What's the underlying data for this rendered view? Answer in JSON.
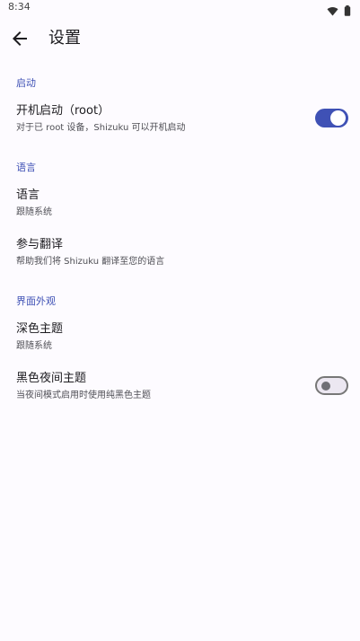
{
  "status_bar": {
    "time": "8:34",
    "icons": [
      "wifi-icon",
      "battery-icon"
    ]
  },
  "app_bar": {
    "title": "设置",
    "back_icon": "arrow-back-icon"
  },
  "sections": {
    "startup": {
      "title": "启动",
      "boot": {
        "title": "开机启动（root）",
        "subtitle": "对于已 root 设备，Shizuku 可以开机启动",
        "enabled": true
      }
    },
    "language": {
      "title": "语言",
      "language_item": {
        "title": "语言",
        "subtitle": "跟随系统"
      },
      "translate_item": {
        "title": "参与翻译",
        "subtitle": "帮助我们将 Shizuku 翻译至您的语言"
      }
    },
    "appearance": {
      "title": "界面外观",
      "dark_theme": {
        "title": "深色主题",
        "subtitle": "跟随系统"
      },
      "black_night": {
        "title": "黑色夜间主题",
        "subtitle": "当夜间模式启用时使用纯黑色主题",
        "enabled": false
      }
    }
  },
  "colors": {
    "accent": "#3f51b5",
    "background": "#fdfbff",
    "text_primary": "#1c1b1f",
    "text_secondary": "#4f4f55"
  }
}
